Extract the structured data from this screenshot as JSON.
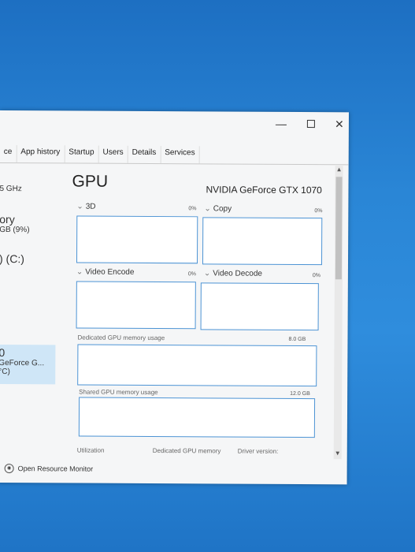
{
  "window": {
    "controls": {
      "minimize": "—",
      "close": "✕"
    },
    "tabs": [
      "ce",
      "App history",
      "Startup",
      "Users",
      "Details",
      "Services"
    ]
  },
  "sidebar": {
    "items": [
      {
        "line1": "5 GHz"
      },
      {
        "line1": "ory",
        "line2": "GB (9%)"
      },
      {
        "line1": ") (C:)"
      },
      {
        "line1": "0",
        "line2": "GeForce G...",
        "line3": "°C)"
      }
    ]
  },
  "gpu": {
    "title": "GPU",
    "name": "NVIDIA GeForce GTX 1070",
    "graphs": [
      {
        "label": "3D",
        "percent": "0%"
      },
      {
        "label": "Copy",
        "percent": "0%"
      },
      {
        "label": "Video Encode",
        "percent": "0%"
      },
      {
        "label": "Video Decode",
        "percent": "0%"
      }
    ],
    "dedicated_label": "Dedicated GPU memory usage",
    "dedicated_max": "8.0 GB",
    "shared_label": "Shared GPU memory usage",
    "shared_max": "12.0 GB",
    "bottom": {
      "utilization": "Utilization",
      "dedicated_memory": "Dedicated GPU memory",
      "driver_version": "Driver version:"
    }
  },
  "footer": {
    "open_resource_monitor": "Open Resource Monitor"
  }
}
